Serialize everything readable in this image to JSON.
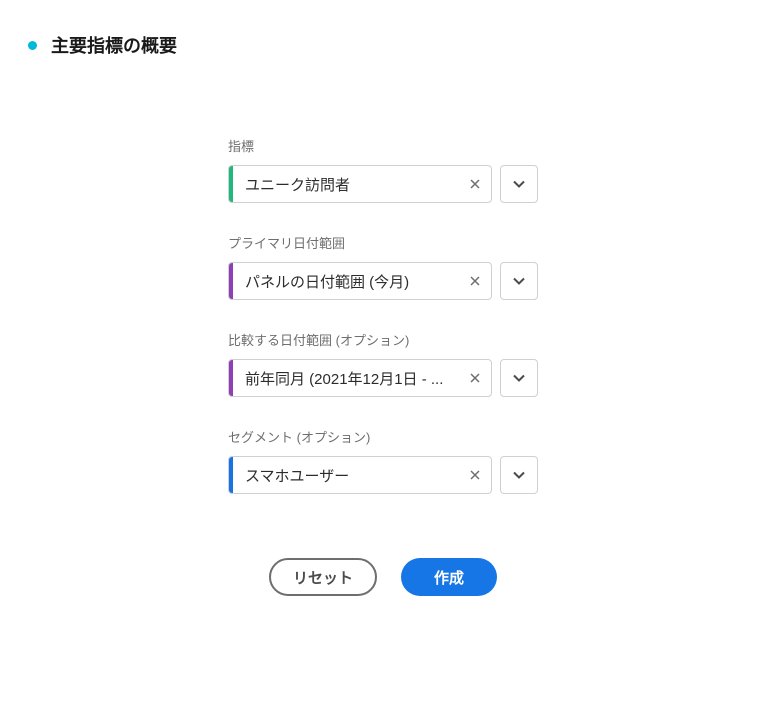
{
  "header": {
    "title": "主要指標の概要"
  },
  "fields": {
    "metric": {
      "label": "指標",
      "value": "ユニーク訪問者",
      "color": "green"
    },
    "primaryDateRange": {
      "label": "プライマリ日付範囲",
      "value": "パネルの日付範囲 (今月)",
      "color": "purple"
    },
    "compareDateRange": {
      "label": "比較する日付範囲 (オプション)",
      "value": "前年同月 (2021年12月1日 - ...",
      "color": "purple"
    },
    "segment": {
      "label": "セグメント (オプション)",
      "value": "スマホユーザー",
      "color": "blue"
    }
  },
  "buttons": {
    "reset": "リセット",
    "create": "作成"
  }
}
